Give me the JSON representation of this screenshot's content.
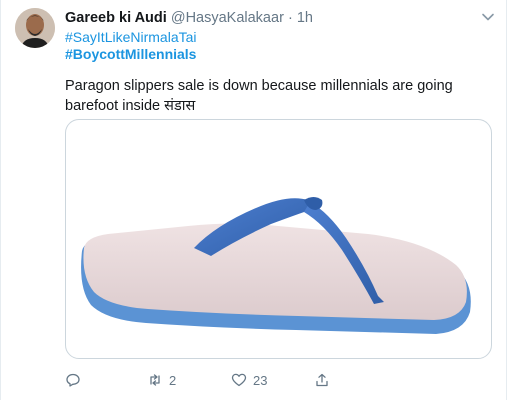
{
  "tweet": {
    "author_name": "Gareeb ki Audi",
    "handle": "@HasyaKalakaar",
    "separator": "·",
    "time": "1h",
    "hashtags": [
      "#SayItLikeNirmalaTai",
      "#BoycottMillennials"
    ],
    "text": "Paragon slippers sale is down because millennials are going barefoot inside संडास",
    "image_subject": "slipper",
    "colors": {
      "link": "#1b95e0",
      "muted": "#657786",
      "strap": "#3f6fbf",
      "sole_top": "#e8d9da",
      "sole_edge": "#5b93d4"
    }
  },
  "actions": {
    "reply_count": "",
    "retweet_count": "2",
    "like_count": "23",
    "share_count": ""
  }
}
